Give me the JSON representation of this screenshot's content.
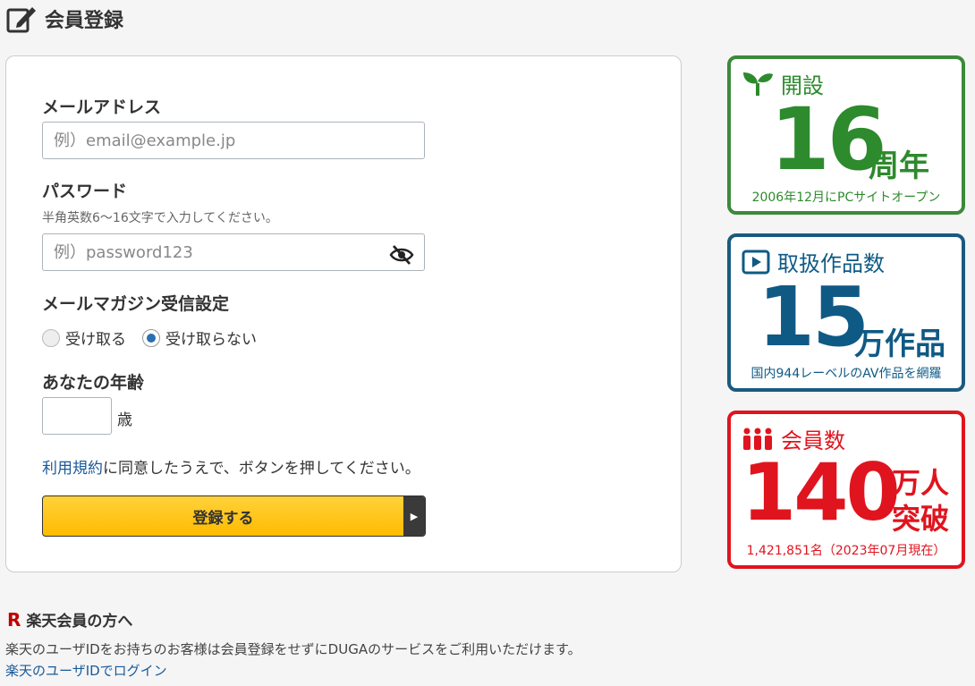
{
  "header": {
    "title": "会員登録"
  },
  "form": {
    "email_label": "メールアドレス",
    "email_placeholder": "例）email@example.jp",
    "password_label": "パスワード",
    "password_hint": "半角英数6～16文字で入力してください。",
    "password_placeholder": "例）password123",
    "newsletter_label": "メールマガジン受信設定",
    "newsletter_options": [
      {
        "label": "受け取る",
        "selected": false
      },
      {
        "label": "受け取らない",
        "selected": true
      }
    ],
    "age_label": "あなたの年齢",
    "age_value": "",
    "age_unit": "歳",
    "terms_link": "利用規約",
    "terms_text": "に同意したうえで、ボタンを押してください。",
    "submit_label": "登録する"
  },
  "stats": {
    "founded": {
      "heading": "開設",
      "number": "16",
      "unit": "周年",
      "note": "2006年12月にPCサイトオープン",
      "color": "#2d8a2d"
    },
    "works": {
      "heading": "取扱作品数",
      "number": "15",
      "unit": "万作品",
      "note": "国内944レーベルのAV作品を網羅",
      "color": "#0f5a85"
    },
    "members": {
      "heading": "会員数",
      "number": "140",
      "unit_line1": "万人",
      "unit_line2": "突破",
      "note": "1,421,851名（2023年07月現在）",
      "color": "#e0141e"
    }
  },
  "rakuten": {
    "logo": "R",
    "heading": "楽天会員の方へ",
    "text": "楽天のユーザIDをお持ちのお客様は会員登録をせずにDUGAのサービスをご利用いただけます。",
    "link": "楽天のユーザIDでログイン"
  }
}
